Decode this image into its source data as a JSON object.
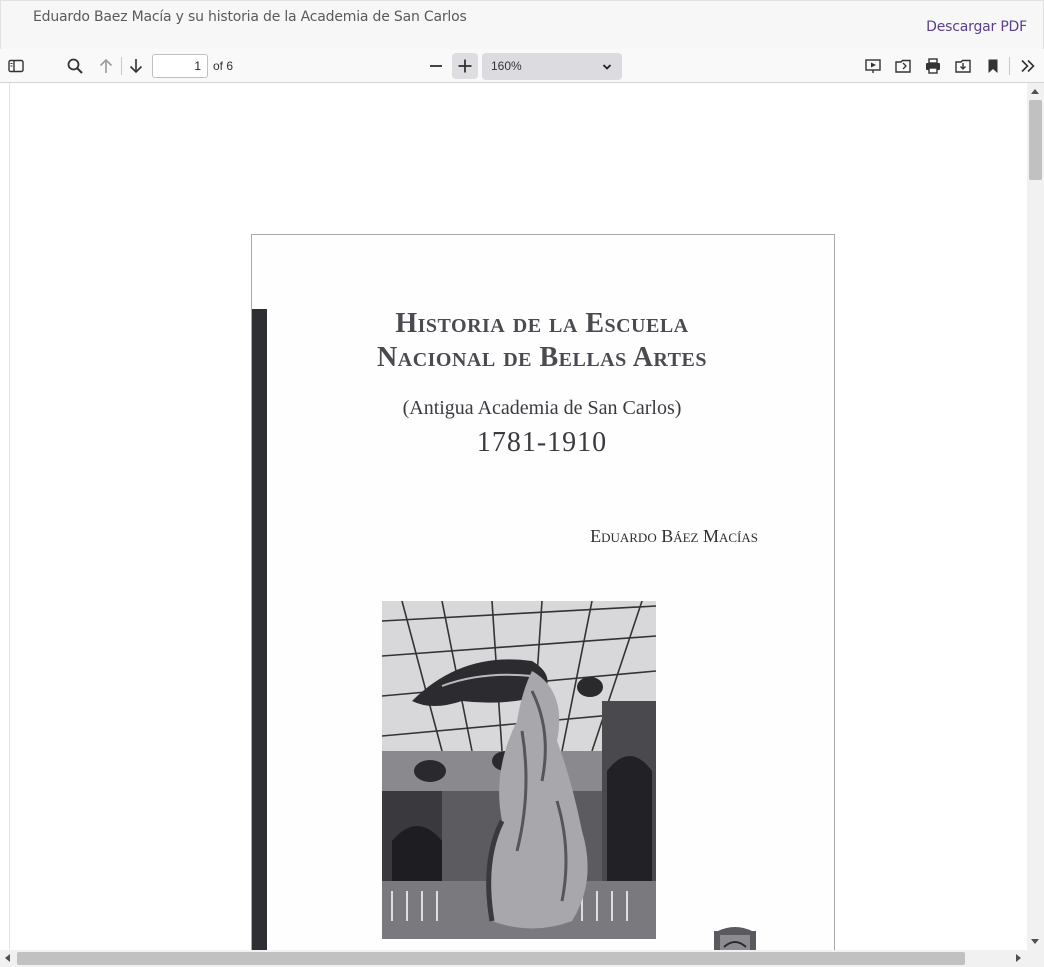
{
  "header": {
    "document_title": "Eduardo Baez Macía y su historia de la Academia de San Carlos",
    "download_label": "Descargar PDF"
  },
  "toolbar": {
    "current_page": "1",
    "page_count_label": "of 6",
    "zoom_value": "160%",
    "buttons": {
      "sidebar": "sidebar-toggle-icon",
      "find": "search-icon",
      "previous": "arrow-up-icon",
      "next": "arrow-down-icon",
      "zoom_out": "minus-icon",
      "zoom_in": "plus-icon",
      "presentation": "presentation-icon",
      "open": "open-file-icon",
      "print": "print-icon",
      "save": "download-icon",
      "bookmark": "bookmark-icon",
      "tools": "double-chevron-right-icon"
    }
  },
  "page": {
    "title_line1": "Historia de la Escuela",
    "title_line2": "Nacional de Bellas Artes",
    "subtitle": "(Antigua Academia de San Carlos)",
    "years": "1781-1910",
    "author": "Eduardo Báez Macías"
  },
  "colors": {
    "download_link": "#5b3f8a",
    "toolbar_bg": "#f9f9fa",
    "zoom_select_bg": "#dcdce0",
    "spine": "#2e2e33"
  }
}
